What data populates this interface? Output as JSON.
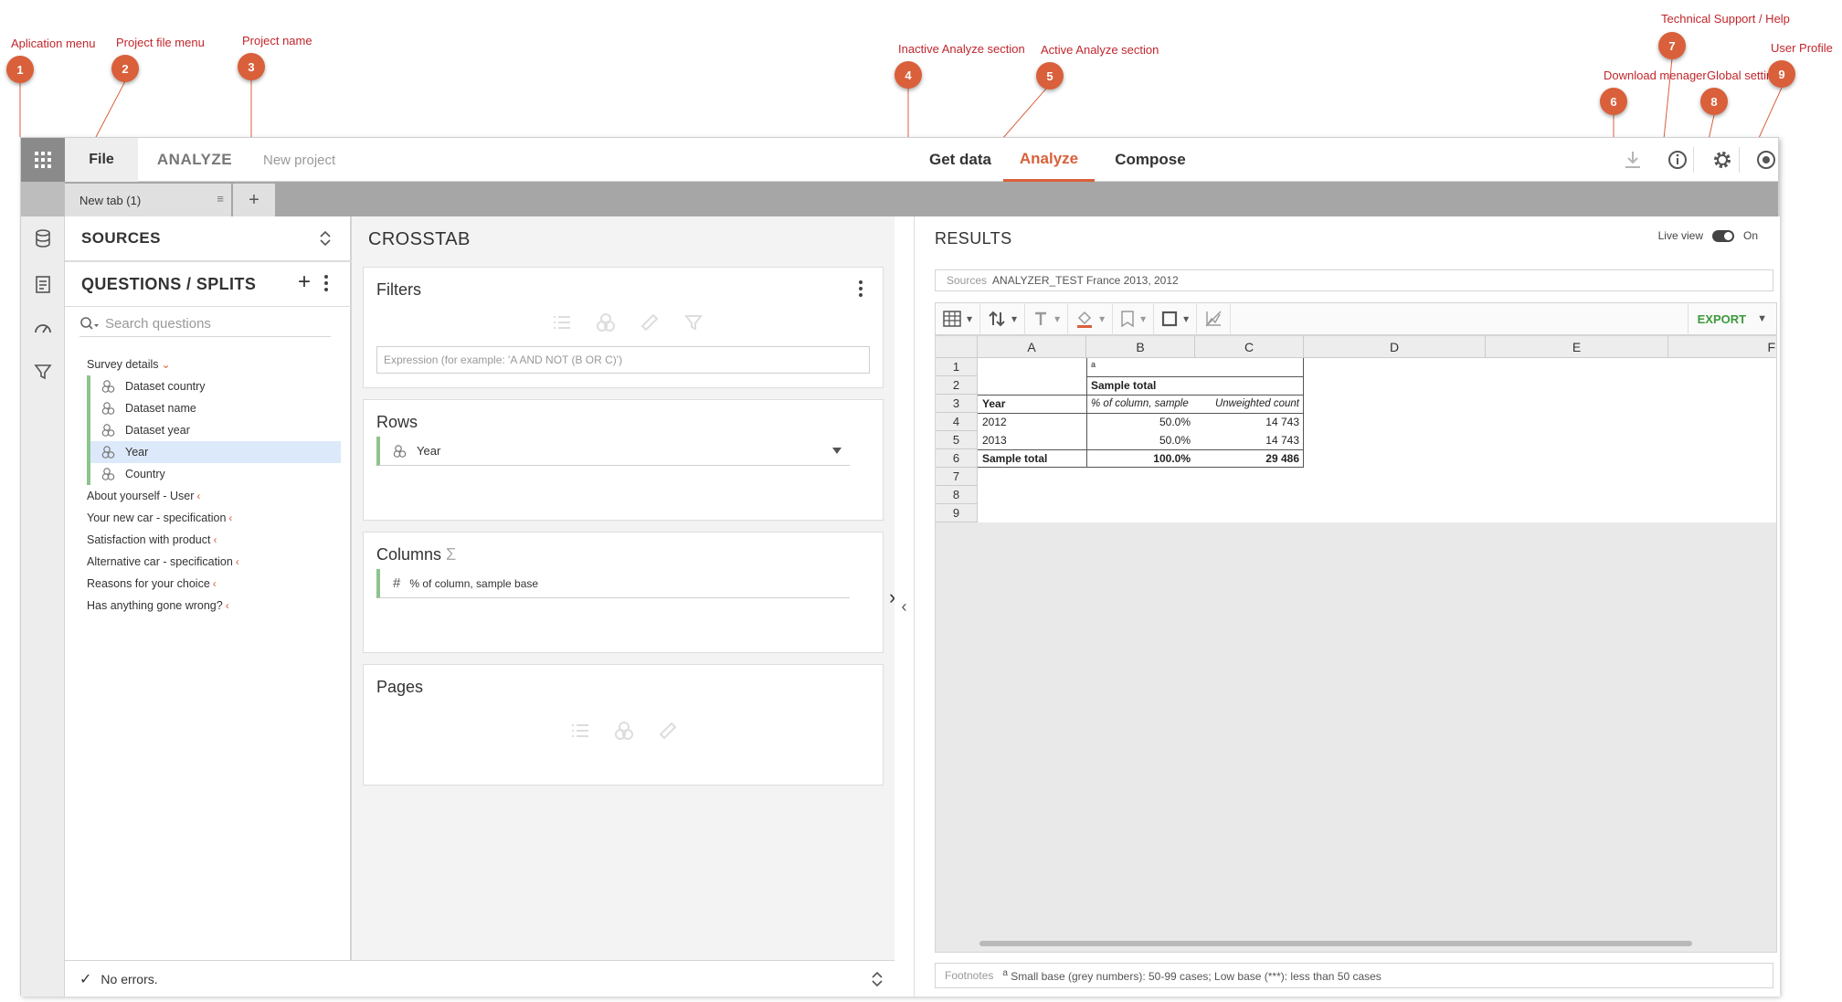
{
  "annotations": [
    {
      "num": "1",
      "label": "Aplication menu"
    },
    {
      "num": "2",
      "label": "Project file menu"
    },
    {
      "num": "3",
      "label": "Project name"
    },
    {
      "num": "4",
      "label": "Inactive Analyze section"
    },
    {
      "num": "5",
      "label": "Active Analyze section"
    },
    {
      "num": "6",
      "label": "Download menager"
    },
    {
      "num": "7",
      "label": "Technical Support / Help"
    },
    {
      "num": "8",
      "label": "Global settings"
    },
    {
      "num": "9",
      "label": "User Profile"
    }
  ],
  "topbar": {
    "file_label": "File",
    "app_label": "ANALYZE",
    "project_name": "New project",
    "nav": [
      {
        "label": "Get data"
      },
      {
        "label": "Analyze"
      },
      {
        "label": "Compose"
      }
    ],
    "icons": [
      "download-icon",
      "info-icon",
      "gear-icon",
      "user-icon"
    ]
  },
  "tabs": {
    "items": [
      {
        "label": "New tab (1)",
        "menu": "≡"
      }
    ],
    "add": "+"
  },
  "left": {
    "sources_title": "SOURCES",
    "questions_title": "QUESTIONS / SPLITS",
    "add": "+",
    "search_placeholder": "Search questions",
    "tree": [
      {
        "label": "Survey details",
        "chev": "⌄",
        "children": [
          "Dataset country",
          "Dataset name",
          "Dataset year",
          "Year",
          "Country"
        ],
        "selected": "Year"
      },
      {
        "label": "About yourself - User",
        "chev": "‹"
      },
      {
        "label": "Your new car - specification",
        "chev": "‹"
      },
      {
        "label": "Satisfaction with product",
        "chev": "‹"
      },
      {
        "label": "Alternative car - specification",
        "chev": "‹"
      },
      {
        "label": "Reasons for your choice",
        "chev": "‹"
      },
      {
        "label": "Has anything gone wrong?",
        "chev": "‹"
      }
    ]
  },
  "status": {
    "text": "No errors."
  },
  "crosstab": {
    "title": "CROSSTAB",
    "filters": {
      "title": "Filters",
      "placeholder": "Expression (for example: 'A AND NOT (B OR C)')"
    },
    "rows": {
      "title": "Rows",
      "item": "Year"
    },
    "columns": {
      "title": "Columns",
      "sigma": "Σ",
      "item_prefix": "#",
      "item": "% of column, sample base"
    },
    "pages": {
      "title": "Pages"
    }
  },
  "results": {
    "title": "RESULTS",
    "live_view_label": "Live view",
    "live_view_state": "On",
    "sources_label": "Sources",
    "sources_value": "ANALYZER_TEST France 2013, 2012",
    "export_label": "EXPORT",
    "columns": [
      "A",
      "B",
      "C",
      "D",
      "E",
      "F"
    ],
    "rows": [
      "1",
      "2",
      "3",
      "4",
      "5",
      "6",
      "7",
      "8",
      "9"
    ],
    "table": {
      "r1": {
        "b": "a"
      },
      "r2": {
        "b": "Sample total"
      },
      "r3": {
        "a": "Year",
        "b": "% of column, sample",
        "c": "Unweighted count"
      },
      "r4": {
        "a": "2012",
        "b": "50.0%",
        "c": "14 743"
      },
      "r5": {
        "a": "2013",
        "b": "50.0%",
        "c": "14 743"
      },
      "r6": {
        "a": "Sample total",
        "b": "100.0%",
        "c": "29 486"
      }
    },
    "footnotes_label": "Footnotes",
    "footnote_sup": "a",
    "footnote_text": "Small base (grey numbers): 50-99 cases; Low base (***): less than 50 cases"
  }
}
